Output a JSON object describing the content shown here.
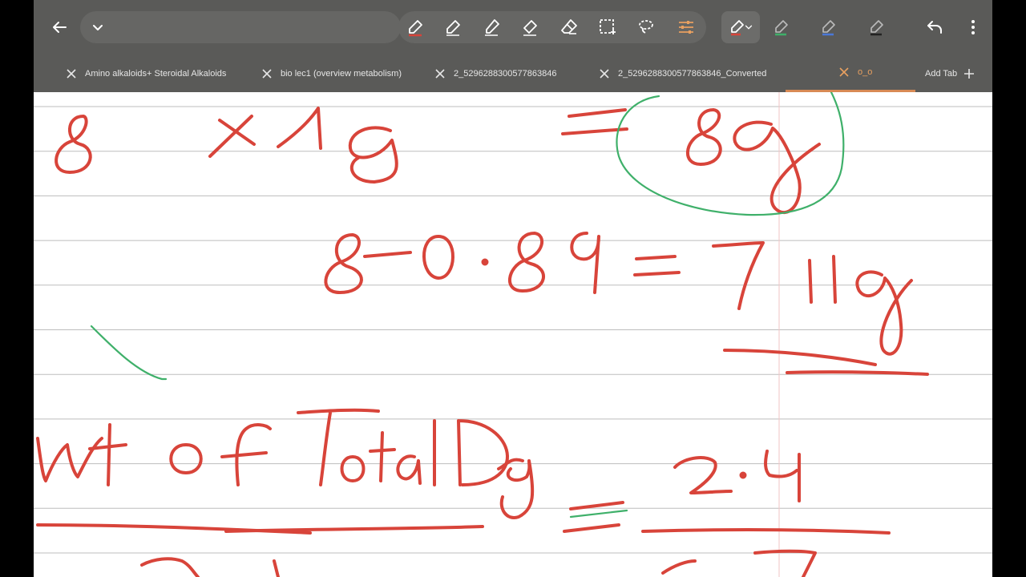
{
  "toolbar": {
    "tools": [
      "pen",
      "pen-alt",
      "pen-fine",
      "highlighter",
      "eraser",
      "selection",
      "lasso",
      "settings"
    ],
    "right_pens": [
      "pen-red",
      "pen-green",
      "pen-blue",
      "pen-gray"
    ]
  },
  "tabs": [
    {
      "label": "Amino alkaloids+ Steroidal Alkaloids",
      "active": false
    },
    {
      "label": "bio lec1 (overview metabolism)",
      "active": false
    },
    {
      "label": "2_5296288300577863846",
      "active": false
    },
    {
      "label": "2_5296288300577863846_Converted",
      "active": false
    },
    {
      "label": "o_o",
      "active": true
    }
  ],
  "add_tab_label": "Add Tab",
  "colors": {
    "toolbar": "#5a5a58",
    "ink_red": "#d8443a",
    "ink_green": "#3fb06a",
    "line_gray": "#bdbdbd",
    "accent_orange": "#d88a55"
  }
}
